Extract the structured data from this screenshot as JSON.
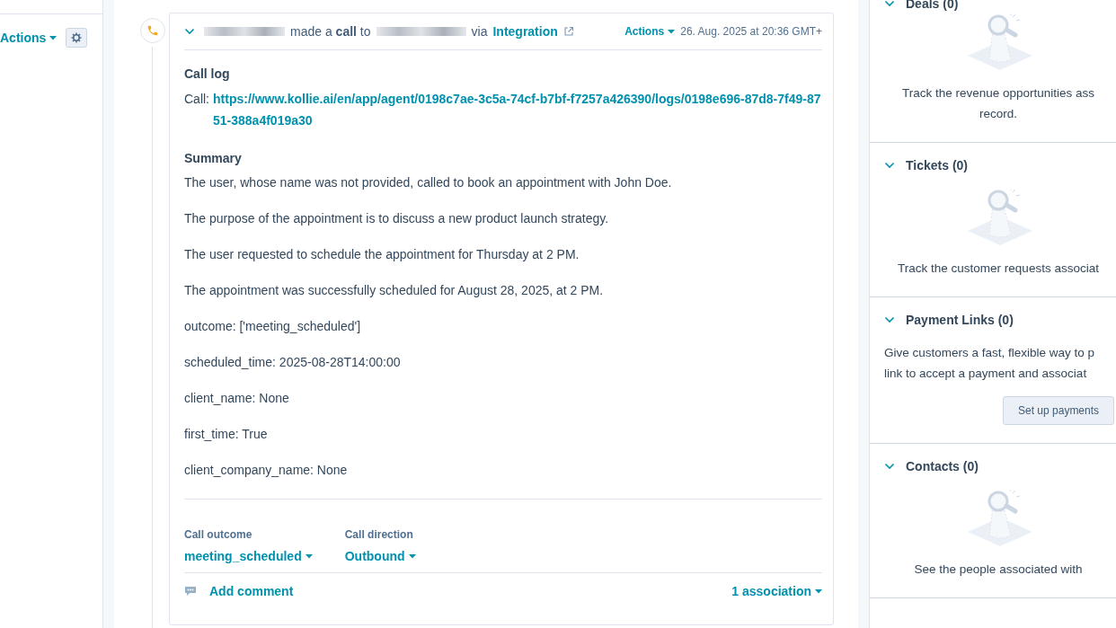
{
  "left": {
    "actions_label": "Actions"
  },
  "activity": {
    "headline": {
      "verb": "made a",
      "bold": "call",
      "prep": "to",
      "via": "via",
      "source": "Integration"
    },
    "actions_label": "Actions",
    "timestamp": "26. Aug. 2025 at 20:36 GMT+",
    "expanded": true,
    "body": [
      {
        "kind": "heading",
        "text": "Call log"
      },
      {
        "kind": "link",
        "label": "Call:",
        "url": "https://www.kollie.ai/en/app/agent/0198c7ae-3c5a-74cf-b7bf-f7257a426390/logs/0198e696-87d8-7f49-8751-388a4f019a30"
      },
      {
        "kind": "heading",
        "text": "Summary"
      },
      {
        "kind": "para",
        "text": "The user, whose name was not provided, called to book an appointment with John Doe."
      },
      {
        "kind": "para",
        "text": "The purpose of the appointment is to discuss a new product launch strategy."
      },
      {
        "kind": "para",
        "text": "The user requested to schedule the appointment for Thursday at 2 PM."
      },
      {
        "kind": "para",
        "text": "The appointment was successfully scheduled for August 28, 2025, at 2 PM."
      },
      {
        "kind": "para",
        "text": "outcome: ['meeting_scheduled']"
      },
      {
        "kind": "para",
        "text": "scheduled_time: 2025-08-28T14:00:00"
      },
      {
        "kind": "para",
        "text": "client_name: None"
      },
      {
        "kind": "para",
        "text": "first_time: True"
      },
      {
        "kind": "para",
        "text": "client_company_name: None"
      }
    ],
    "properties": [
      {
        "label": "Call outcome",
        "value": "meeting_scheduled"
      },
      {
        "label": "Call direction",
        "value": "Outbound"
      }
    ],
    "add_comment": "Add comment",
    "associations": "1 association"
  },
  "sidebar": [
    {
      "kind": "empty",
      "title": "Deals (0)",
      "expanded": true,
      "lines": [
        "Track the revenue opportunities ass",
        "record."
      ]
    },
    {
      "kind": "empty",
      "title": "Tickets (0)",
      "expanded": true,
      "lines": [
        "Track the customer requests associat"
      ]
    },
    {
      "kind": "action",
      "title": "Payment Links (0)",
      "expanded": true,
      "lines": [
        "Give customers a fast, flexible way to p",
        "link to accept a payment and associat"
      ],
      "button": "Set up payments"
    },
    {
      "kind": "empty",
      "title": "Contacts (0)",
      "expanded": true,
      "lines": [
        "See the people associated with"
      ]
    }
  ]
}
